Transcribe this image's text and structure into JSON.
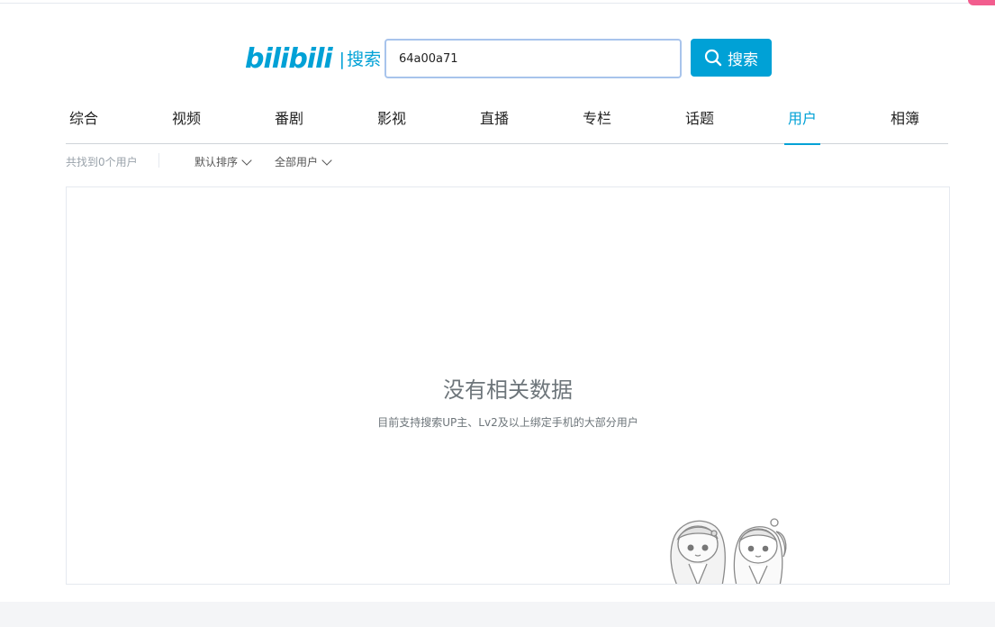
{
  "header": {
    "logo_text": "bilibili",
    "logo_separator": "|",
    "search_title": "搜索"
  },
  "search": {
    "query": "64a00a71",
    "button_label": "搜索"
  },
  "tabs": [
    {
      "label": "综合",
      "active": false
    },
    {
      "label": "视频",
      "active": false
    },
    {
      "label": "番剧",
      "active": false
    },
    {
      "label": "影视",
      "active": false
    },
    {
      "label": "直播",
      "active": false
    },
    {
      "label": "专栏",
      "active": false
    },
    {
      "label": "话题",
      "active": false
    },
    {
      "label": "用户",
      "active": true
    },
    {
      "label": "相簿",
      "active": false
    }
  ],
  "filters": {
    "result_count": "共找到0个用户",
    "sort_label": "默认排序",
    "user_type_label": "全部用户"
  },
  "empty_state": {
    "title": "没有相关数据",
    "subtitle": "目前支持搜索UP主、Lv2及以上绑定手机的大部分用户"
  },
  "colors": {
    "accent": "#00a1d6",
    "pink": "#f25d8e"
  }
}
